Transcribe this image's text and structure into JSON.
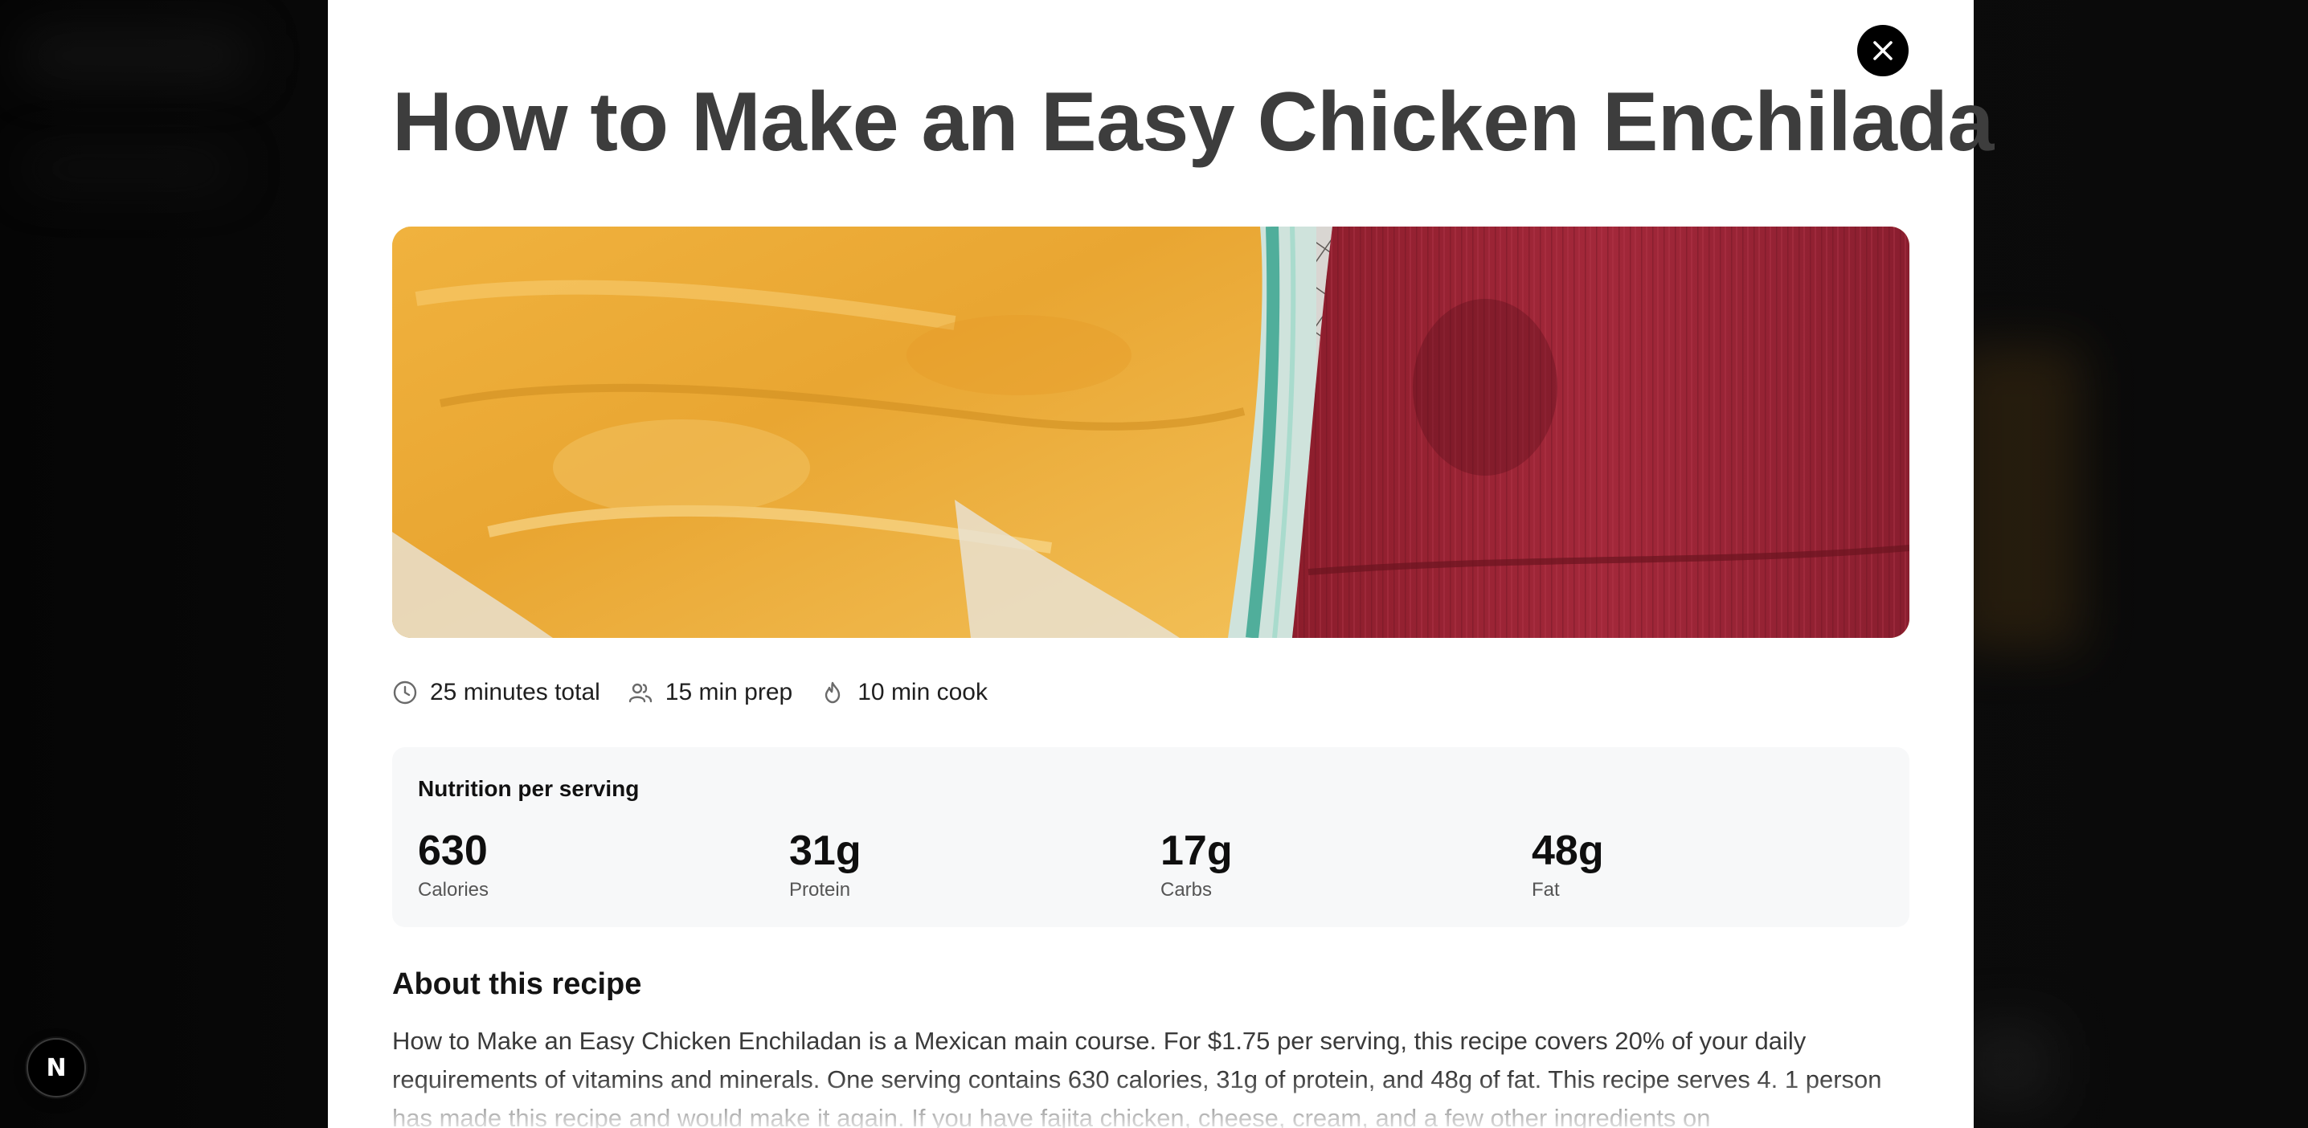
{
  "modal": {
    "title": "How to Make an Easy Chicken Enchilada",
    "image_alt": "Cheesy chicken enchiladas in a glass baking dish next to a red towel"
  },
  "meta": {
    "total_time": "25 minutes total",
    "prep_time": "15 min prep",
    "cook_time": "10 min cook"
  },
  "nutrition": {
    "heading": "Nutrition per serving",
    "items": [
      {
        "value": "630",
        "label": "Calories"
      },
      {
        "value": "31g",
        "label": "Protein"
      },
      {
        "value": "17g",
        "label": "Carbs"
      },
      {
        "value": "48g",
        "label": "Fat"
      }
    ]
  },
  "about": {
    "heading": "About this recipe",
    "text": "How to Make an Easy Chicken Enchiladan is a Mexican main course. For $1.75 per serving, this recipe covers 20% of your daily requirements of vitamins and minerals. One serving contains 630 calories, 31g of protein, and 48g of fat. This recipe serves 4. 1 person has made this recipe and would make it again. If you have fajita chicken, cheese, cream, and a few other ingredients on"
  },
  "dev_indicator": {
    "letter": "N"
  },
  "icons": {
    "close": "close-icon",
    "total_time": "clock-icon",
    "prep_time": "users-icon",
    "cook_time": "flame-icon"
  },
  "colors": {
    "overlay": "#0b0b0b",
    "title": "#3d3d3d",
    "nutrition_bg": "#f7f8f9"
  }
}
